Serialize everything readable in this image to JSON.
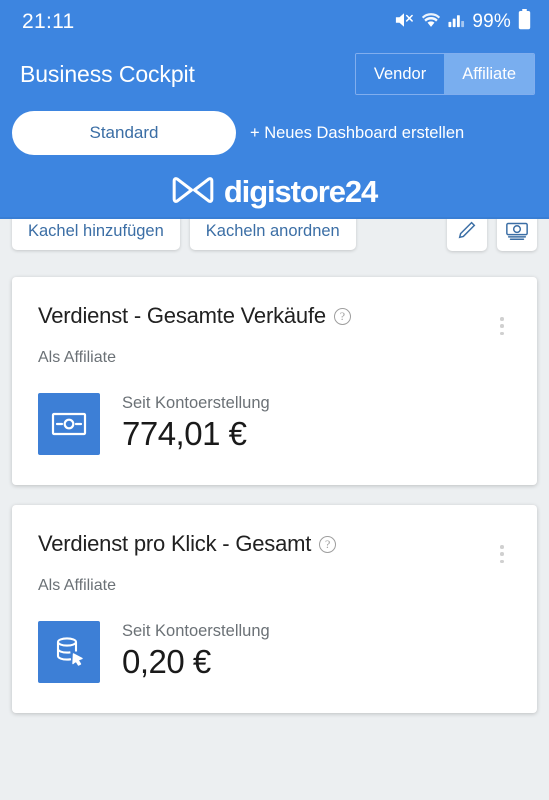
{
  "status_bar": {
    "time": "21:11",
    "battery_percent": "99%",
    "icons": [
      "mute-icon",
      "wifi-icon",
      "signal-icon",
      "battery-icon"
    ]
  },
  "header": {
    "app_title": "Business Cockpit",
    "role_toggle": {
      "options": [
        "Vendor",
        "Affiliate"
      ],
      "selected": "Affiliate"
    },
    "dashboard_button": "Standard",
    "new_dashboard_link": "+ Neues Dashboard erstellen",
    "brand": "digistore24",
    "brand_color": "#3d85e0"
  },
  "toolbar": {
    "add_tile": "Kachel hinzufügen",
    "arrange_tiles": "Kacheln anordnen",
    "edit_icon": "pencil-icon",
    "screenshot_icon": "camera-icon"
  },
  "cards": [
    {
      "title": "Verdienst - Gesamte Verkäufe",
      "help": "?",
      "role": "Als Affiliate",
      "icon": "banknote-icon",
      "metric_label": "Seit Kontoerstellung",
      "metric_value": "774,01 €"
    },
    {
      "title": "Verdienst pro Klick - Gesamt",
      "help": "?",
      "role": "Als Affiliate",
      "icon": "database-click-icon",
      "metric_label": "Seit Kontoerstellung",
      "metric_value": "0,20 €"
    }
  ],
  "colors": {
    "accent": "#3d85e0",
    "tile_icon_bg": "#3d7fd6",
    "page_bg": "#eceff1",
    "card_bg": "#ffffff"
  }
}
